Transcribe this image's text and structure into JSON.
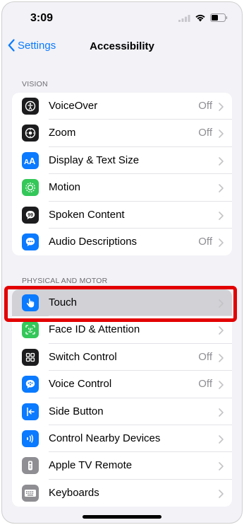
{
  "status": {
    "time": "3:09"
  },
  "nav": {
    "back_label": "Settings",
    "title": "Accessibility"
  },
  "sections": {
    "vision": {
      "header": "VISION",
      "items": [
        {
          "label": "VoiceOver",
          "value": "Off",
          "icon": "voiceover-icon",
          "color": "#1c1c1e"
        },
        {
          "label": "Zoom",
          "value": "Off",
          "icon": "zoom-icon",
          "color": "#1c1c1e"
        },
        {
          "label": "Display & Text Size",
          "value": "",
          "icon": "text-size-icon",
          "color": "#0a7aff"
        },
        {
          "label": "Motion",
          "value": "",
          "icon": "motion-icon",
          "color": "#34c759"
        },
        {
          "label": "Spoken Content",
          "value": "",
          "icon": "speech-bubble-icon",
          "color": "#1c1c1e"
        },
        {
          "label": "Audio Descriptions",
          "value": "Off",
          "icon": "audio-description-icon",
          "color": "#0a7aff"
        }
      ]
    },
    "physical": {
      "header": "PHYSICAL AND MOTOR",
      "items": [
        {
          "label": "Touch",
          "value": "",
          "icon": "hand-icon",
          "color": "#0a7aff",
          "highlighted": true
        },
        {
          "label": "Face ID & Attention",
          "value": "",
          "icon": "face-id-icon",
          "color": "#34c759"
        },
        {
          "label": "Switch Control",
          "value": "Off",
          "icon": "switch-control-icon",
          "color": "#1c1c1e"
        },
        {
          "label": "Voice Control",
          "value": "Off",
          "icon": "voice-control-icon",
          "color": "#0a7aff"
        },
        {
          "label": "Side Button",
          "value": "",
          "icon": "side-button-icon",
          "color": "#0a7aff"
        },
        {
          "label": "Control Nearby Devices",
          "value": "",
          "icon": "nearby-devices-icon",
          "color": "#0a7aff"
        },
        {
          "label": "Apple TV Remote",
          "value": "",
          "icon": "tv-remote-icon",
          "color": "#8e8e93"
        },
        {
          "label": "Keyboards",
          "value": "",
          "icon": "keyboard-icon",
          "color": "#8e8e93"
        }
      ]
    }
  }
}
